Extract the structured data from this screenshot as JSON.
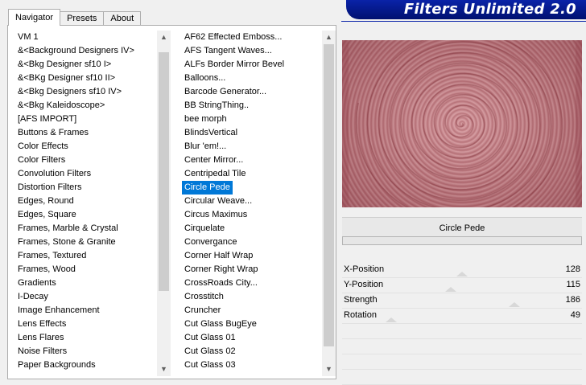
{
  "tabs": [
    "Navigator",
    "Presets",
    "About"
  ],
  "banner": {
    "title": "Filters Unlimited 2.0"
  },
  "categories": {
    "items": [
      "VM 1",
      "&<Background Designers IV>",
      "&<Bkg Designer sf10 I>",
      "&<BKg Designer sf10 II>",
      "&<Bkg Designers sf10 IV>",
      "&<Bkg Kaleidoscope>",
      "[AFS IMPORT]",
      "Buttons & Frames",
      "Color Effects",
      "Color Filters",
      "Convolution Filters",
      "Distortion Filters",
      "Edges, Round",
      "Edges, Square",
      "Frames, Marble & Crystal",
      "Frames, Stone & Granite",
      "Frames, Textured",
      "Frames, Wood",
      "Gradients",
      "I-Decay",
      "Image Enhancement",
      "Lens Effects",
      "Lens Flares",
      "Noise Filters",
      "Paper Backgrounds"
    ],
    "thumb_position": 0.1,
    "thumb_size": 0.75
  },
  "filters": {
    "items": [
      "AF62 Effected Emboss...",
      "AFS Tangent Waves...",
      "ALFs Border Mirror Bevel",
      "Balloons...",
      "Barcode Generator...",
      "BB StringThing..",
      "bee morph",
      "BlindsVertical",
      "Blur 'em!...",
      "Center Mirror...",
      "Centripedal Tile",
      "Circle Pede",
      "Circular Weave...",
      "Circus Maximus",
      "Cirquelate",
      "Convergance",
      "Corner Half Wrap",
      "Corner Right Wrap",
      "CrossRoads City...",
      "Crosstitch",
      "Cruncher",
      "Cut Glass  BugEye",
      "Cut Glass 01",
      "Cut Glass 02",
      "Cut Glass 03"
    ],
    "selected": "Circle Pede",
    "thumb_position": 0.0,
    "thumb_size": 0.95
  },
  "current_filter": "Circle Pede",
  "params": [
    {
      "name": "X-Position",
      "value": "128",
      "level": 0.5
    },
    {
      "name": "Y-Position",
      "value": "115",
      "level": 0.45
    },
    {
      "name": "Strength",
      "value": "186",
      "level": 0.73
    },
    {
      "name": "Rotation",
      "value": "49",
      "level": 0.19
    }
  ],
  "colors": {
    "selection": "#0078d7",
    "banner": "#0a23a8",
    "preview_base": "#c27f85"
  },
  "icons": {
    "scroll_up": "▲",
    "scroll_down": "▼"
  }
}
